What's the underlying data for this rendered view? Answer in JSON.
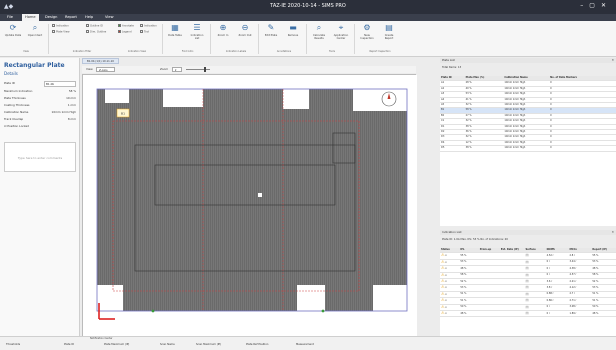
{
  "window": {
    "title": "TAZ-IE 2020-10-14 - SIMS PRO"
  },
  "menu": [
    "File",
    "Home",
    "Design",
    "Report",
    "Help",
    "View"
  ],
  "menu_active": 1,
  "ribbon": {
    "buttons": [
      {
        "label": "Update Data",
        "icon": "refresh-icon"
      },
      {
        "label": "Open Ident",
        "icon": "search-icon"
      },
      {
        "label": "Data Table",
        "icon": "table-icon"
      },
      {
        "label": "Indication List",
        "icon": "list-icon"
      },
      {
        "label": "Zoom In",
        "icon": "zoom-in-icon"
      },
      {
        "label": "Zoom Out",
        "icon": "zoom-out-icon"
      },
      {
        "label": "Edit Plate",
        "icon": "pencil-icon"
      },
      {
        "label": "Remove",
        "icon": "minus-icon"
      },
      {
        "label": "Calculate Results",
        "icon": "calculator-icon"
      },
      {
        "label": "Application Center",
        "icon": "center-icon"
      },
      {
        "label": "New Inspection",
        "icon": "inspection-icon"
      },
      {
        "label": "Create Report",
        "icon": "report-icon"
      }
    ],
    "small_options": [
      "Indication",
      "Plate View",
      "Outline ID",
      "Dim. Outline",
      "Annotate",
      "Legend",
      "Indication",
      "Tool",
      "Invert"
    ],
    "groups": [
      "View",
      "Indication Filter",
      "Indication View",
      "Find Indic.",
      "Indication Labels",
      "Annotations",
      "Tools",
      "Report Inspection"
    ]
  },
  "details": {
    "title": "Rectangular Plate",
    "subtitle": "Details",
    "fields": [
      {
        "label": "Plate ID",
        "value": "B1.0b"
      },
      {
        "label": "Maximum Indication",
        "value": "58 %"
      },
      {
        "label": "Plate Thickness",
        "value": "10 mm"
      },
      {
        "label": "Coating Thickness",
        "value": "1 mm"
      },
      {
        "label": "Calibration Name",
        "value": "10mm 1mm High"
      },
      {
        "label": "Track Overlap",
        "value": "8 mm"
      },
      {
        "label": "Position Locked",
        "value": ""
      }
    ],
    "comment_placeholder": "Type here to enter comments"
  },
  "center": {
    "doc_tab": "B1.0b (1/1) 10.11.10",
    "view_label": "View",
    "view_value": "Z-Axis",
    "zoom_label": "Zoom",
    "indication_label": "B1"
  },
  "plates": {
    "header": "Plate List",
    "count": "Total Items: 13",
    "columns": [
      "Plate ID",
      "Plate Max (%)",
      "Calibration Name",
      "No. of Rate Markers"
    ],
    "rows": [
      [
        "A1",
        "28 %",
        "10mm 1mm High",
        "0"
      ],
      [
        "A2",
        "40 %",
        "10mm 1mm High",
        "0"
      ],
      [
        "A3",
        "53 %",
        "10mm 1mm High",
        "0"
      ],
      [
        "A4",
        "41 %",
        "10mm 1mm High",
        "0"
      ],
      [
        "A5",
        "32 %",
        "10mm 1mm High",
        "0"
      ],
      [
        "B1",
        "58 %",
        "10mm 1mm High",
        "0"
      ],
      [
        "B2",
        "27 %",
        "10mm 1mm High",
        "0"
      ],
      [
        "C1",
        "32 %",
        "10mm 1mm High",
        "0"
      ],
      [
        "D1",
        "38 %",
        "10mm 1mm High",
        "0"
      ],
      [
        "D2",
        "36 %",
        "10mm 1mm High",
        "0"
      ],
      [
        "D3",
        "32 %",
        "10mm 1mm High",
        "0"
      ],
      [
        "D4",
        "12 %",
        "10mm 1mm High",
        "0"
      ],
      [
        "D5",
        "38 %",
        "10mm 1mm High",
        "0"
      ]
    ],
    "selected_row": 5
  },
  "indications": {
    "header": "Indication List",
    "summary": "Plate ID: 1.0A    Max. IPL: 53 %    No. of Indications: 20",
    "columns": [
      "Status",
      "IPL",
      "Prom-up",
      "Ext. Rate (IP)",
      "Surface",
      "DOMS",
      "MCCs",
      "Report (IP)"
    ],
    "rows": [
      [
        "",
        "55 %",
        "",
        "",
        "",
        "4.52 r",
        "2.8 r",
        "55 %"
      ],
      [
        "",
        "53 %",
        "",
        "",
        "",
        "0 r",
        "3.44 r",
        "53 %"
      ],
      [
        "",
        "48 %",
        "",
        "",
        "",
        "0 r",
        "4.38 r",
        "48 %"
      ],
      [
        "",
        "58 %",
        "",
        "",
        "",
        "0 r",
        "4.57 r",
        "58 %"
      ],
      [
        "",
        "52 %",
        "",
        "",
        "",
        "3.6 r",
        "2.21 r",
        "52 %"
      ],
      [
        "",
        "53 %",
        "",
        "",
        "",
        "3.8 r",
        "4.12 r",
        "53 %"
      ],
      [
        "",
        "51 %",
        "",
        "",
        "",
        "0.88 r",
        "2.7 r",
        "51 %"
      ],
      [
        "",
        "51 %",
        "",
        "",
        "",
        "0.86 r",
        "2.71 r",
        "51 %"
      ],
      [
        "",
        "50 %",
        "",
        "",
        "",
        "0 r",
        "3.08 r",
        "50 %"
      ],
      [
        "",
        "48 %",
        "",
        "",
        "",
        "0 r",
        "1.89 r",
        "48 %"
      ]
    ]
  },
  "status_tabs": [
    "Notification Center"
  ],
  "status_columns": [
    "Thresholds",
    "Plate ID",
    "Plate Maximum (IP)",
    "Scan Name",
    "Scan Maximum (IP)",
    "Plate Ref Position",
    "Measurement"
  ]
}
